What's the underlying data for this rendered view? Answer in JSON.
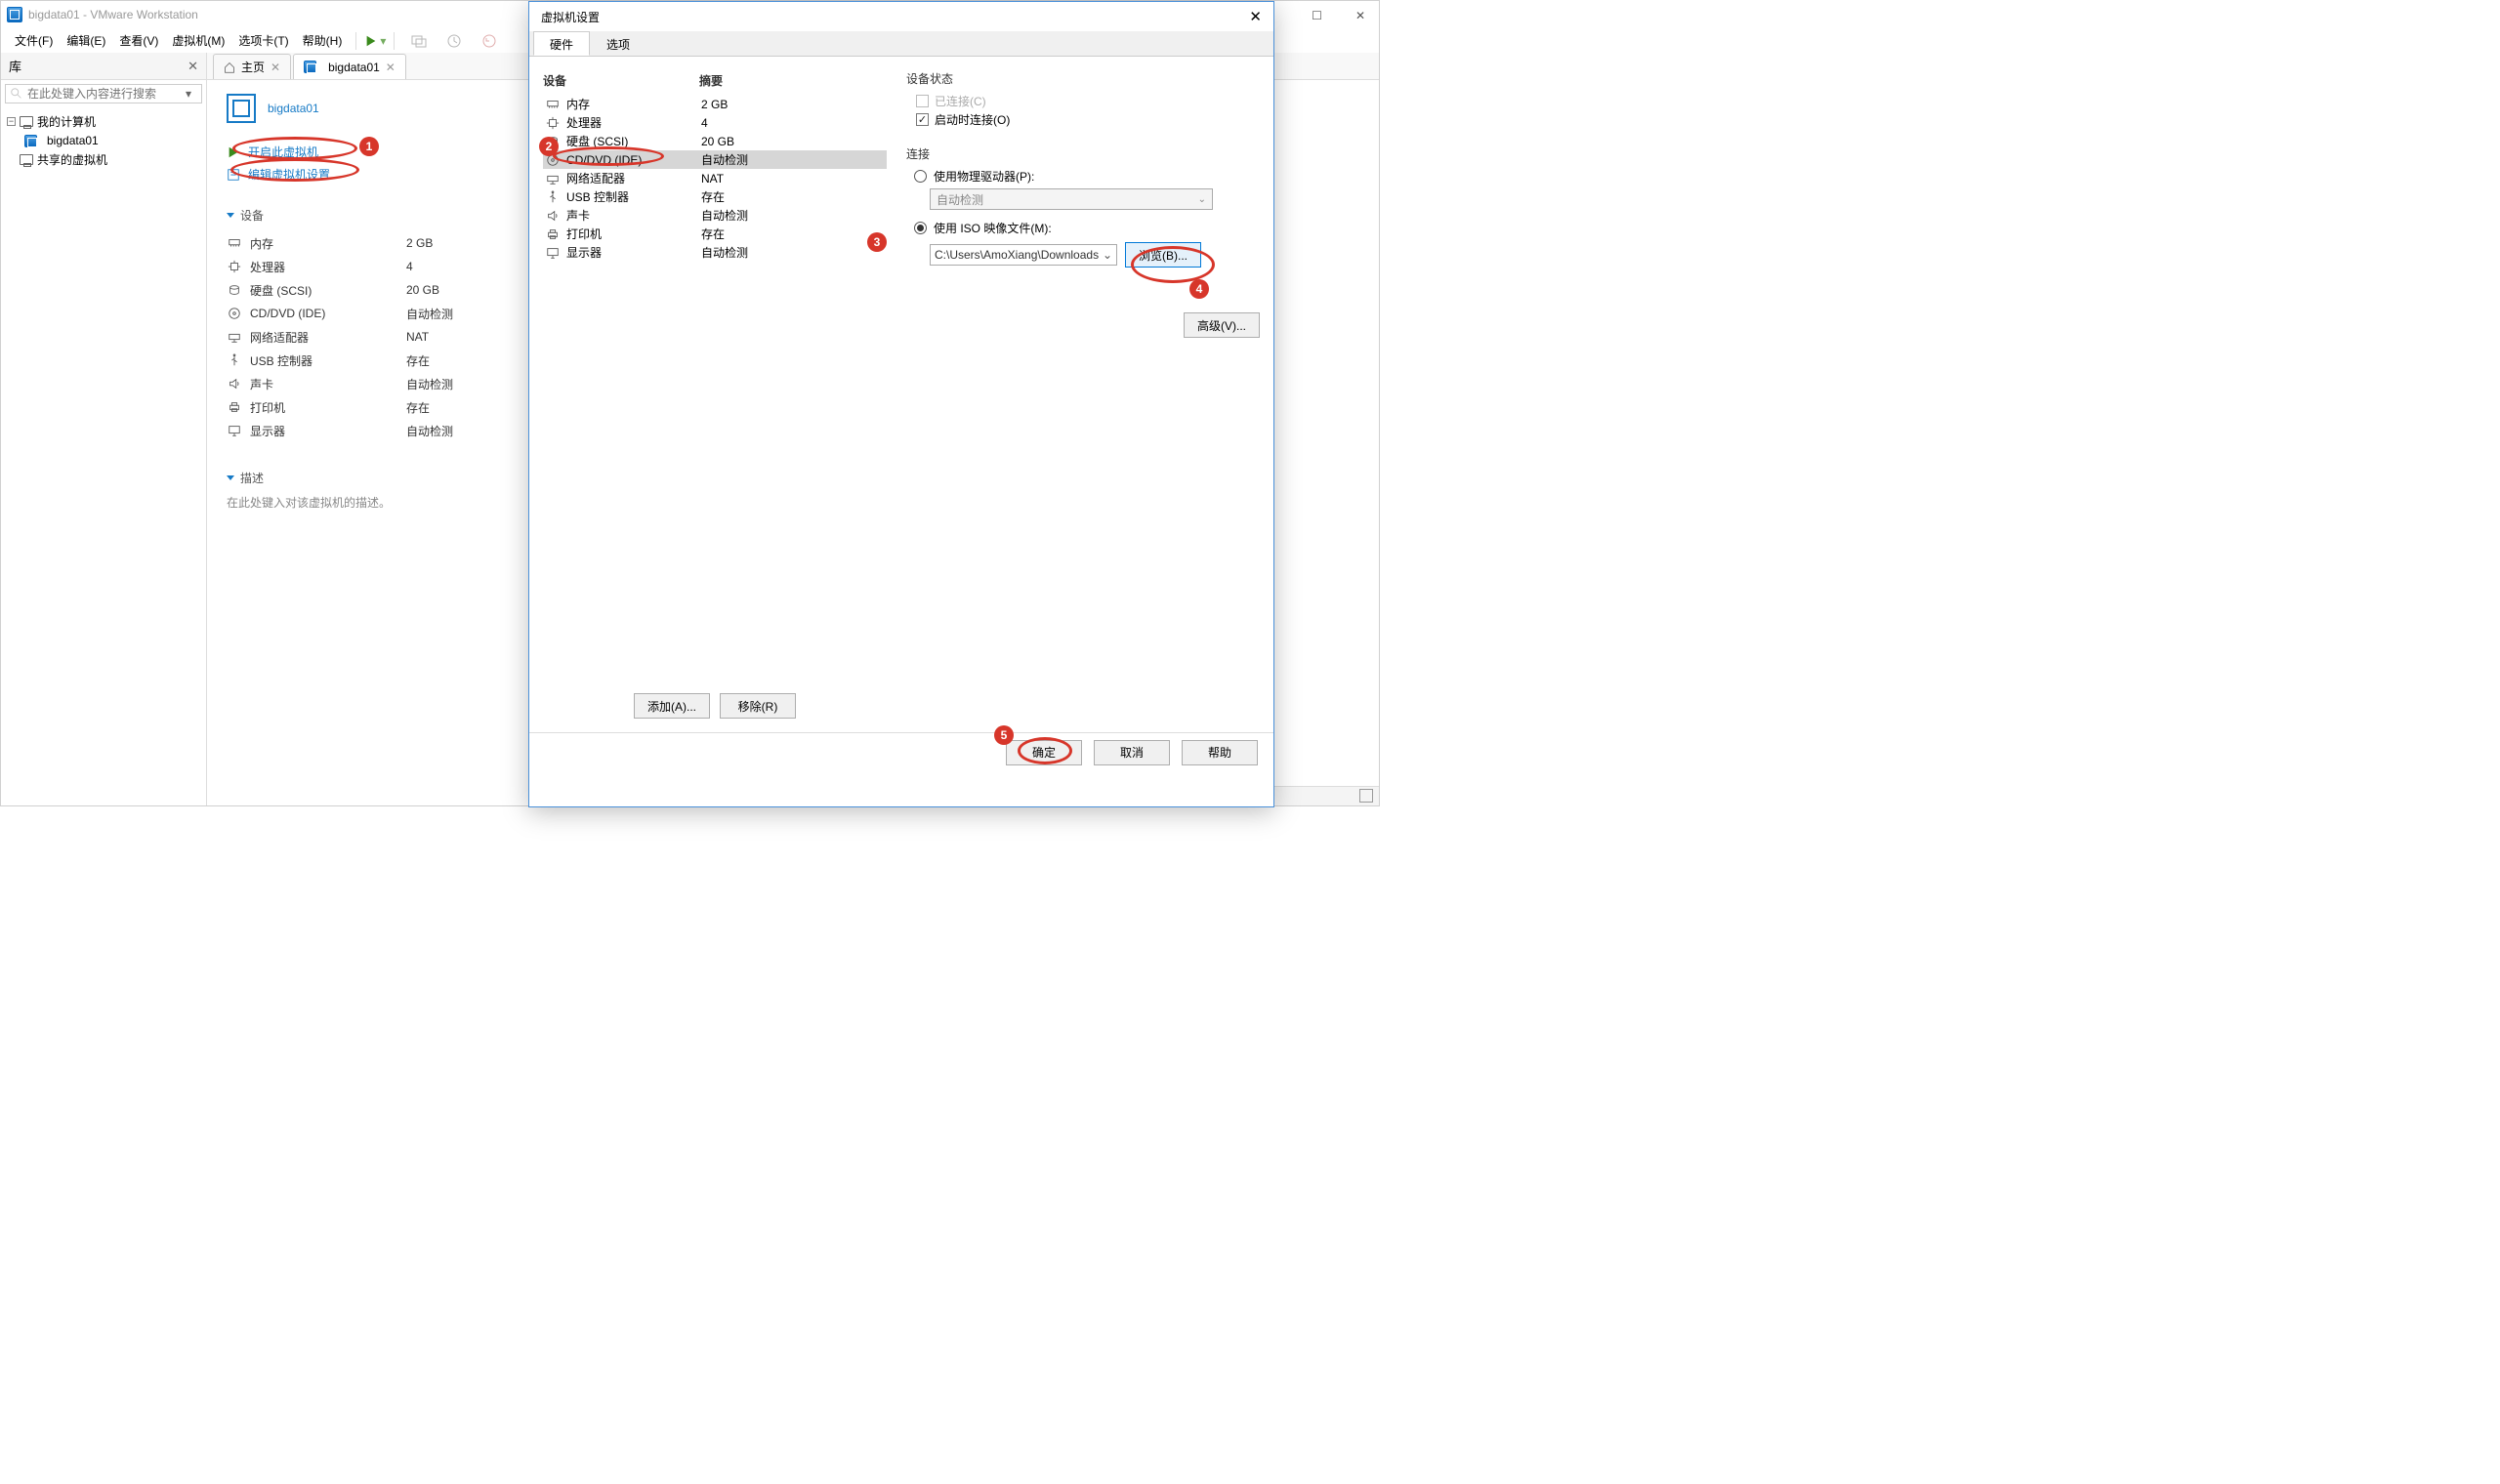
{
  "window": {
    "title": "bigdata01 - VMware Workstation"
  },
  "menu": {
    "file": "文件(F)",
    "edit": "编辑(E)",
    "view": "查看(V)",
    "vm": "虚拟机(M)",
    "tabs": "选项卡(T)",
    "help": "帮助(H)"
  },
  "library": {
    "title": "库",
    "search_placeholder": "在此处键入内容进行搜索",
    "root": "我的计算机",
    "vm": "bigdata01",
    "shared": "共享的虚拟机"
  },
  "tabs": {
    "home": "主页",
    "vm": "bigdata01"
  },
  "vmpage": {
    "title": "bigdata01",
    "start": "开启此虚拟机",
    "edit": "编辑虚拟机设置",
    "devices_header": "设备",
    "description_header": "描述",
    "description_placeholder": "在此处键入对该虚拟机的描述。",
    "devices": [
      {
        "name": "内存",
        "value": "2 GB",
        "icon": "mem"
      },
      {
        "name": "处理器",
        "value": "4",
        "icon": "cpu"
      },
      {
        "name": "硬盘 (SCSI)",
        "value": "20 GB",
        "icon": "hdd"
      },
      {
        "name": "CD/DVD (IDE)",
        "value": "自动检测",
        "icon": "cd"
      },
      {
        "name": "网络适配器",
        "value": "NAT",
        "icon": "net"
      },
      {
        "name": "USB 控制器",
        "value": "存在",
        "icon": "usb"
      },
      {
        "name": "声卡",
        "value": "自动检测",
        "icon": "sound"
      },
      {
        "name": "打印机",
        "value": "存在",
        "icon": "printer"
      },
      {
        "name": "显示器",
        "value": "自动检测",
        "icon": "display"
      }
    ]
  },
  "dialog": {
    "title": "虚拟机设置",
    "tab_hardware": "硬件",
    "tab_options": "选项",
    "col_device": "设备",
    "col_summary": "摘要",
    "devices": [
      {
        "name": "内存",
        "summary": "2 GB",
        "icon": "mem"
      },
      {
        "name": "处理器",
        "summary": "4",
        "icon": "cpu"
      },
      {
        "name": "硬盘 (SCSI)",
        "summary": "20 GB",
        "icon": "hdd"
      },
      {
        "name": "CD/DVD (IDE)",
        "summary": "自动检测",
        "icon": "cd",
        "selected": true
      },
      {
        "name": "网络适配器",
        "summary": "NAT",
        "icon": "net"
      },
      {
        "name": "USB 控制器",
        "summary": "存在",
        "icon": "usb"
      },
      {
        "name": "声卡",
        "summary": "自动检测",
        "icon": "sound"
      },
      {
        "name": "打印机",
        "summary": "存在",
        "icon": "printer"
      },
      {
        "name": "显示器",
        "summary": "自动检测",
        "icon": "display"
      }
    ],
    "add": "添加(A)...",
    "remove": "移除(R)",
    "device_state": "设备状态",
    "connected": "已连接(C)",
    "connect_on_start": "启动时连接(O)",
    "connection": "连接",
    "use_physical": "使用物理驱动器(P):",
    "auto_detect": "自动检测",
    "use_iso": "使用 ISO 映像文件(M):",
    "iso_path": "C:\\Users\\AmoXiang\\Downloads",
    "browse": "浏览(B)...",
    "advanced": "高级(V)...",
    "ok": "确定",
    "cancel": "取消",
    "help": "帮助"
  },
  "annotations": {
    "a1": "1",
    "a2": "2",
    "a3": "3",
    "a4": "4",
    "a5": "5"
  }
}
